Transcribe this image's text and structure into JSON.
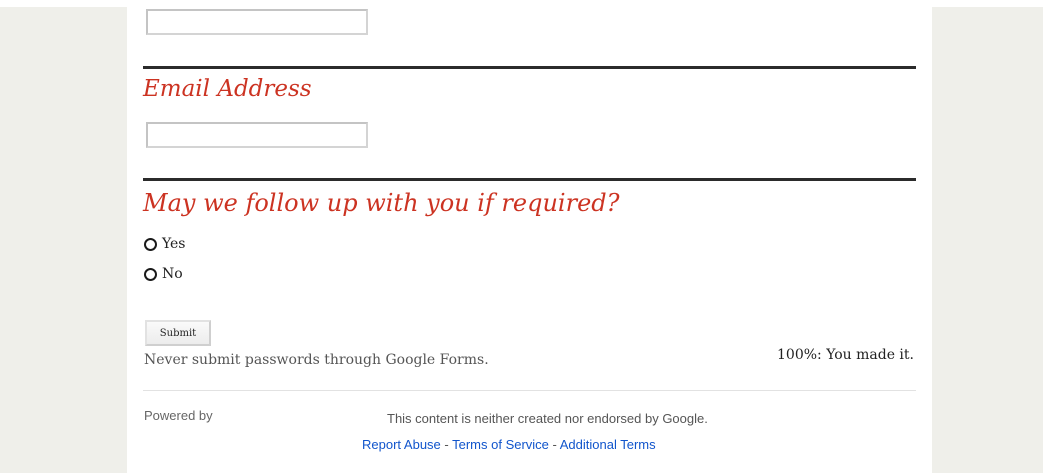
{
  "form": {
    "name_field_value": "",
    "email_heading": "Email Address",
    "email_field_value": "",
    "followup_heading": "May we follow up with you if required?",
    "options": [
      "Yes",
      "No"
    ],
    "submit_label": "Submit",
    "password_warning": "Never submit passwords through Google Forms.",
    "progress_text": "100%: You made it.",
    "progress_value": 1.0
  },
  "footer": {
    "powered_by": "Powered by",
    "disclaimer": "This content is neither created nor endorsed by Google.",
    "link_report": "Report Abuse",
    "link_terms": "Terms of Service",
    "link_additional": "Additional Terms",
    "separator": " - "
  },
  "colors": {
    "heading": "#cc3322",
    "rule": "#2b2b2b",
    "page_bg": "#efefea",
    "link": "#1155cc"
  }
}
